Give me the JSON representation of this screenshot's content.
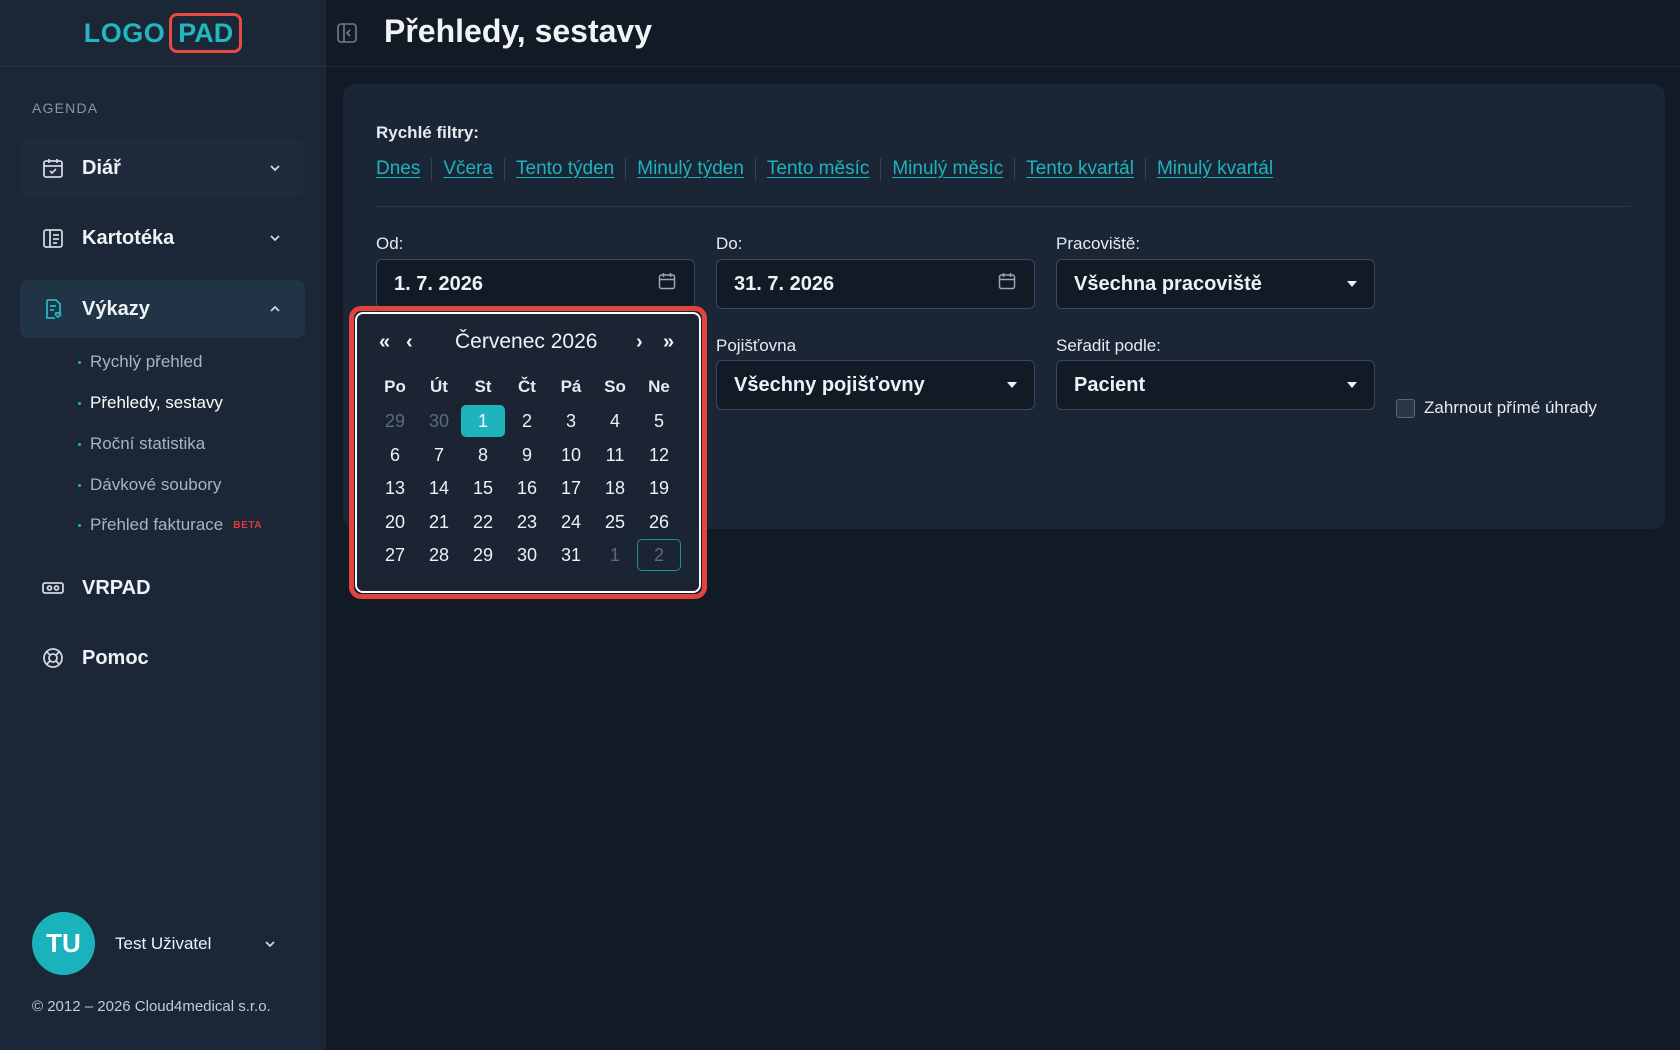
{
  "app": {
    "logo_left": "LOGO",
    "logo_right": "PAD"
  },
  "sidebar": {
    "section_label": "AGENDA",
    "items": [
      {
        "label": "Diář",
        "icon": "calendar-check-icon"
      },
      {
        "label": "Kartotéka",
        "icon": "card-index-icon"
      },
      {
        "label": "Výkazy",
        "icon": "report-icon"
      },
      {
        "label": "VRPAD",
        "icon": "vr-headset-icon"
      },
      {
        "label": "Pomoc",
        "icon": "lifebuoy-icon"
      }
    ],
    "subitems": [
      {
        "label": "Rychlý přehled"
      },
      {
        "label": "Přehledy, sestavy"
      },
      {
        "label": "Roční statistika"
      },
      {
        "label": "Dávkové soubory"
      },
      {
        "label": "Přehled fakturace",
        "badge": "BETA"
      }
    ],
    "user": {
      "initials": "TU",
      "name": "Test Uživatel"
    },
    "copyright": "© 2012 – 2026 Cloud4medical s.r.o."
  },
  "header": {
    "title": "Přehledy, sestavy"
  },
  "filters": {
    "quick_label": "Rychlé filtry:",
    "quick_links": [
      "Dnes",
      "Včera",
      "Tento týden",
      "Minulý týden",
      "Tento měsíc",
      "Minulý měsíc",
      "Tento kvartál",
      "Minulý kvartál"
    ],
    "from_label": "Od:",
    "from_value": "1. 7. 2026",
    "to_label": "Do:",
    "to_value": "31. 7. 2026",
    "workplace_label": "Pracoviště:",
    "workplace_value": "Všechna pracoviště",
    "insurance_label": "Pojišťovna",
    "insurance_value": "Všechny pojišťovny",
    "sort_label": "Seřadit podle:",
    "sort_value": "Pacient",
    "direct_payments_label": "Zahrnout přímé úhrady",
    "direct_payments_checked": false
  },
  "calendar": {
    "prev_year": "«",
    "prev_month": "‹",
    "next_month": "›",
    "next_year": "»",
    "title": "Červenec 2026",
    "weekdays": [
      "Po",
      "Út",
      "St",
      "Čt",
      "Pá",
      "So",
      "Ne"
    ],
    "weeks": [
      [
        "29",
        "30",
        "1",
        "2",
        "3",
        "4",
        "5"
      ],
      [
        "6",
        "7",
        "8",
        "9",
        "10",
        "11",
        "12"
      ],
      [
        "13",
        "14",
        "15",
        "16",
        "17",
        "18",
        "19"
      ],
      [
        "20",
        "21",
        "22",
        "23",
        "24",
        "25",
        "26"
      ],
      [
        "27",
        "28",
        "29",
        "30",
        "31",
        "1",
        "2"
      ]
    ],
    "selected_day": "1",
    "accent_color": "#1fb3bd",
    "highlight_color": "#e0453d"
  }
}
